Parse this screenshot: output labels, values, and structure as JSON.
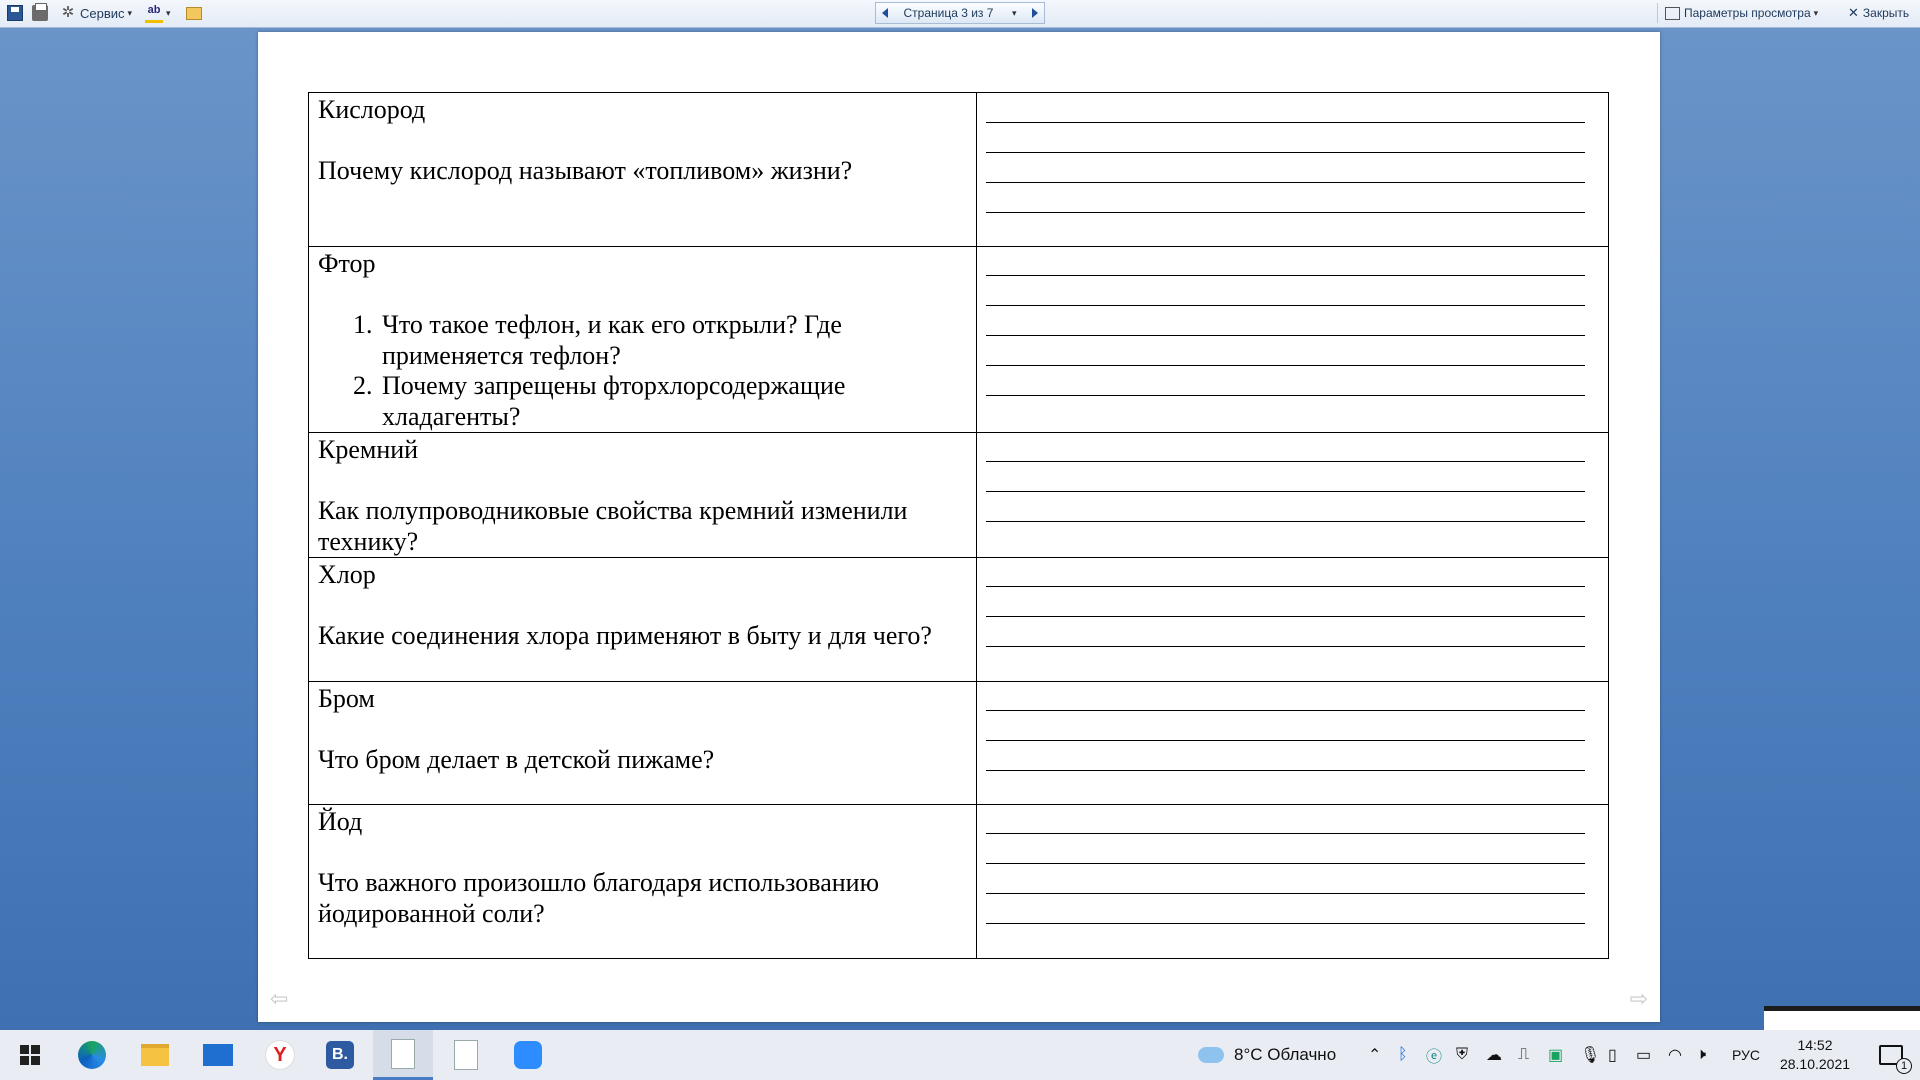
{
  "toolbar": {
    "service_label": "Сервис",
    "page_indicator": "Страница 3 из 7",
    "view_params_label": "Параметры просмотра",
    "close_label": "Закрыть"
  },
  "document": {
    "rows": [
      {
        "title": "Кислород",
        "question": "Почему кислород называют «топливом» жизни?"
      },
      {
        "title": "Фтор",
        "list": [
          "Что такое тефлон, и как его открыли? Где применяется тефлон?",
          "Почему запрещены фторхлорсодержащие хладагенты?"
        ]
      },
      {
        "title": "Кремний",
        "question": "Как полупроводниковые свойства кремний изменили технику?"
      },
      {
        "title": "Хлор",
        "question": "Какие соединения хлора применяют в быту и для чего?"
      },
      {
        "title": "Бром",
        "question": "Что бром делает в детской пижаме?"
      },
      {
        "title": "Йод",
        "question": "Что важного произошло благодаря использованию йодированной соли?"
      }
    ]
  },
  "taskbar": {
    "weather": "8°C  Облачно",
    "language": "РУС",
    "time": "14:52",
    "date": "28.10.2021",
    "notifications_count": "1"
  }
}
